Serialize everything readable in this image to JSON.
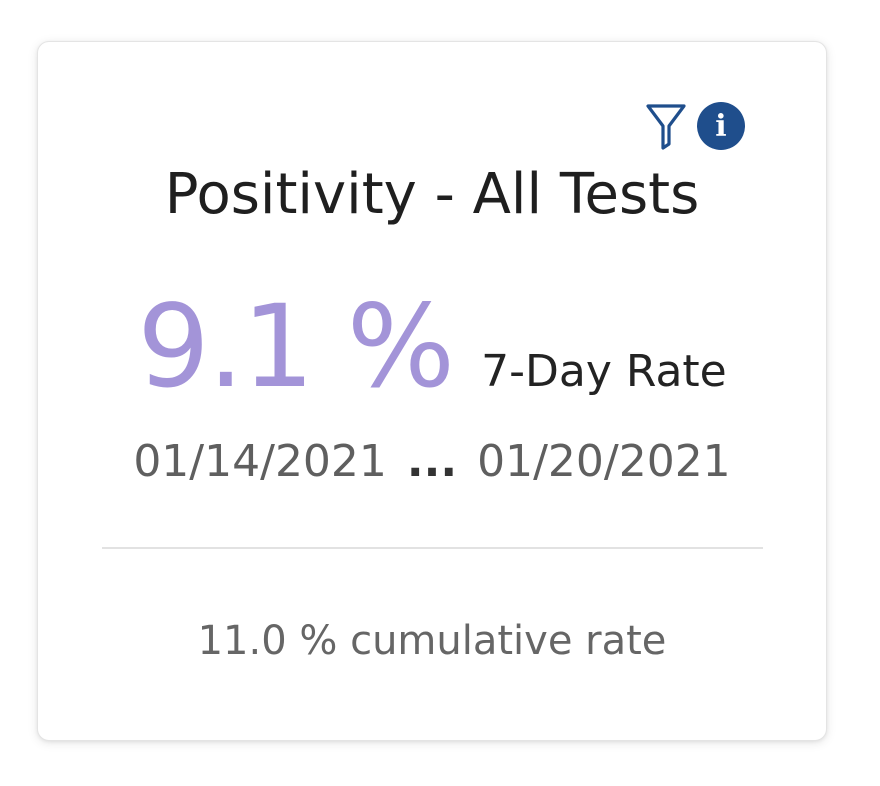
{
  "card": {
    "title": "Positivity - All Tests",
    "value": "9.1 %",
    "value_color": "#a394d8",
    "value_label": "7-Day Rate",
    "date_start": "01/14/2021",
    "date_separator": "...",
    "date_end": "01/20/2021",
    "cumulative_text": "11.0 % cumulative rate",
    "icons": {
      "filter": "filter-icon",
      "info": "info-icon",
      "info_color": "#1f4e8c"
    }
  }
}
